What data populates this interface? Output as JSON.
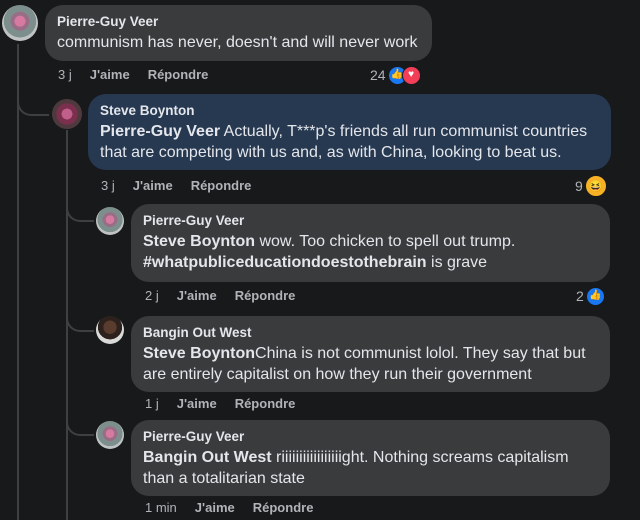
{
  "comments": [
    {
      "author": "Pierre-Guy Veer",
      "mention": "",
      "text": "communism has never, doesn't and will never work",
      "time": "3 j",
      "like_label": "J'aime",
      "reply_label": "Répondre",
      "reaction_count": "24",
      "reactions": [
        "like-icon",
        "love-icon"
      ]
    },
    {
      "author": "Steve Boynton",
      "mention": "Pierre-Guy Veer",
      "text": " Actually, T***p's friends all run communist countries that are competing with us and, as with China, looking to beat us.",
      "time": "3 j",
      "like_label": "J'aime",
      "reply_label": "Répondre",
      "reaction_count": "9",
      "reactions": [
        "haha-icon"
      ]
    },
    {
      "author": "Pierre-Guy Veer",
      "mention": "Steve Boynton",
      "text": " wow. Too chicken to spell out trump.",
      "hashtag": "#whatpubliceducationdoestothebrain",
      "text_after": " is grave",
      "time": "2 j",
      "like_label": "J'aime",
      "reply_label": "Répondre",
      "reaction_count": "2",
      "reactions": [
        "like-icon"
      ]
    },
    {
      "author": "Bangin Out West",
      "mention": "Steve Boynton",
      "text": "China is not communist lolol. They say that but are entirely capitalist on how they run their government",
      "time": "1 j",
      "like_label": "J'aime",
      "reply_label": "Répondre"
    },
    {
      "author": "Pierre-Guy Veer",
      "mention": "Bangin Out West",
      "text": " riiiiiiiiiiiiiiiiight. Nothing screams capitalism than a totalitarian state",
      "time": "1 min",
      "like_label": "J'aime",
      "reply_label": "Répondre"
    }
  ],
  "colors": {
    "background": "#18191a",
    "bubble": "#3a3b3c",
    "highlight_bubble": "#263951",
    "like_blue": "#1877f2",
    "love_red": "#f33e58",
    "haha_yellow": "#f7b125"
  }
}
